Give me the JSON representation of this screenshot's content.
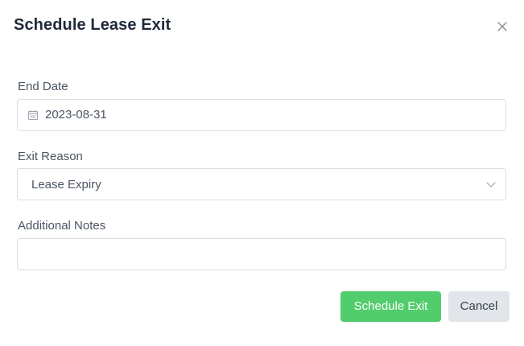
{
  "dialog": {
    "title": "Schedule Lease Exit"
  },
  "end_date": {
    "label": "End Date",
    "value": "2023-08-31"
  },
  "exit_reason": {
    "label": "Exit Reason",
    "selected": "Lease Expiry"
  },
  "notes": {
    "label": "Additional Notes",
    "value": "",
    "placeholder": ""
  },
  "actions": {
    "submit_label": "Schedule Exit",
    "cancel_label": "Cancel"
  },
  "colors": {
    "primary": "#52cd6e",
    "secondary": "#e2e5e9",
    "title": "#1e293b",
    "border": "#d9dde3"
  },
  "icons": {
    "close": "close-icon",
    "calendar": "calendar-icon",
    "chevron": "chevron-down-icon"
  }
}
